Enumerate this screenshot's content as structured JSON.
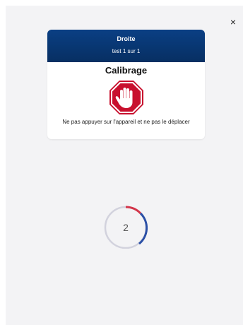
{
  "dialog": {
    "side_label": "Droite",
    "test_label": "test 1 sur 1",
    "title": "Calibrage",
    "message": "Ne pas appuyer sur l'appareil et ne pas le déplacer",
    "icon": "stop-hand-icon"
  },
  "close": {
    "glyph": "×"
  },
  "countdown": {
    "value": "2",
    "progress_colors": [
      "#d3354a",
      "#2a4fa6"
    ],
    "ring_color": "#d2d2dd"
  },
  "colors": {
    "header": "#0a3f84",
    "stop_red": "#c8102e"
  }
}
